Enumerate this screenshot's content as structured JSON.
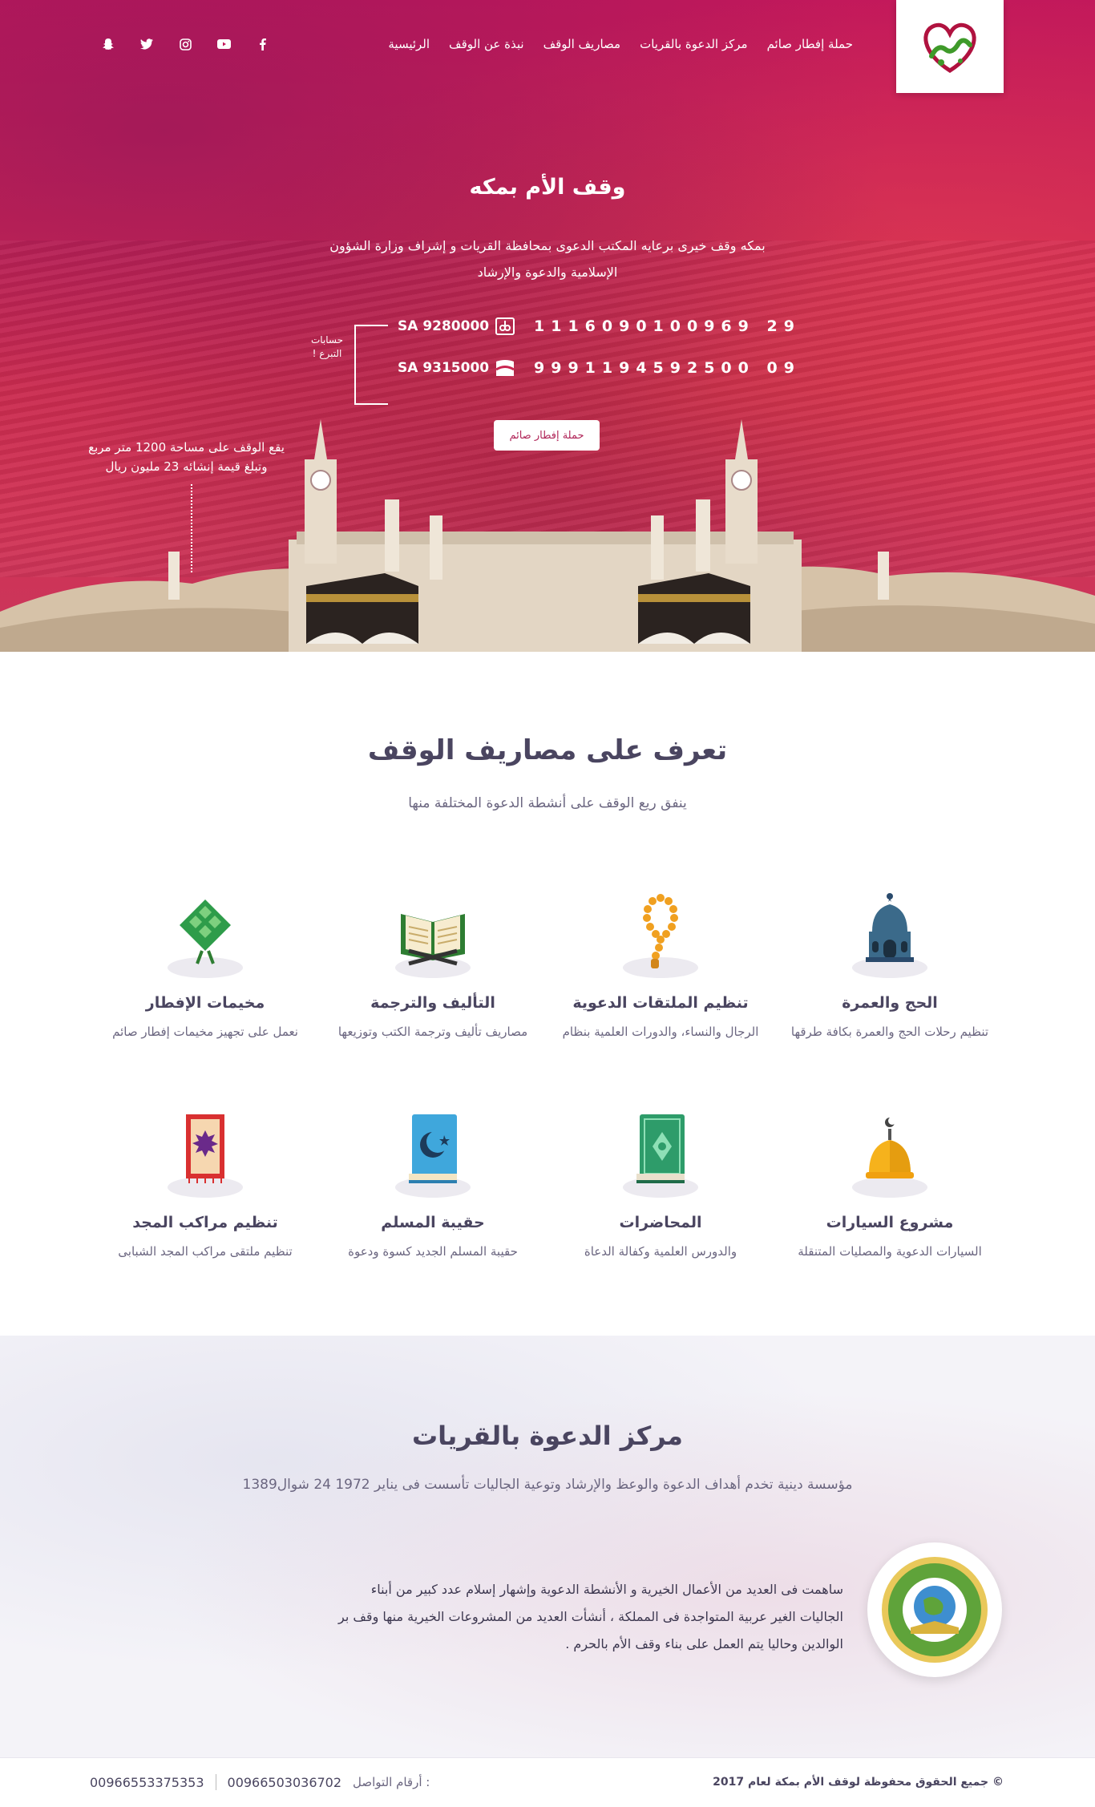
{
  "brand": {
    "logo_icon": "heart-waqf-logo"
  },
  "nav": {
    "items": [
      "الرئيسية",
      "نبذة عن الوقف",
      "مصاريف الوقف",
      "مركز الدعوة بالقريات",
      "حملة إفطار صائم"
    ]
  },
  "social": [
    "facebook-icon",
    "youtube-icon",
    "instagram-icon",
    "twitter-icon",
    "snapchat-icon"
  ],
  "hero": {
    "title": "وقف الأم بمكه",
    "description": "بمكه وقف خيرى برعايه المكتب الدعوى بمحافظة القريات و إشراف وزارة الشؤون الإسلامية والدعوة والإرشاد",
    "accounts_label": "حسابات التبرع !",
    "accounts": [
      {
        "code": "SA 9280000",
        "bank_icon": "alrajhi-bank-icon",
        "number": "1116090100969 29"
      },
      {
        "code": "SA 9315000",
        "bank_icon": "alinma-bank-icon",
        "number": "9991194592500 09"
      }
    ],
    "button": "حملة إفطار صائم",
    "side_note": "يقع الوقف على مساحة 1200 متر مربع وتبلغ قيمة إنشائه 23 مليون ريال"
  },
  "services": {
    "title": "تعرف على مصاريف الوقف",
    "subtitle": "ينفق ريع الوقف على أنشطة الدعوة المختلفة منها",
    "items": [
      {
        "icon": "mosque-dome-icon",
        "title": "الحج والعمرة",
        "desc": "تنظيم رحلات الحج والعمرة بكافة طرقها"
      },
      {
        "icon": "prayer-beads-icon",
        "title": "تنظيم الملتقات الدعوية",
        "desc": "الرجال والنساء، والدورات العلمية بنظام"
      },
      {
        "icon": "open-quran-icon",
        "title": "التأليف والترجمة",
        "desc": "مصاريف تأليف وترجمة الكتب وتوزيعها"
      },
      {
        "icon": "ketupat-icon",
        "title": "مخيمات الإفطار",
        "desc": "نعمل على تجهيز مخيمات إفطار صائم"
      },
      {
        "icon": "golden-dome-icon",
        "title": "مشروع السيارات",
        "desc": "السيارات الدعوية والمصليات المتنقلة"
      },
      {
        "icon": "green-book-icon",
        "title": "المحاضرات",
        "desc": "والدورس العلمية وكفالة الدعاة"
      },
      {
        "icon": "blue-book-crescent-icon",
        "title": "حقيبة المسلم",
        "desc": "حقيبة المسلم الجديد كسوة ودعوة"
      },
      {
        "icon": "prayer-rug-icon",
        "title": "تنظيم مراكب المجد",
        "desc": "تنظيم ملتقى مراكب المجد الشبابى"
      }
    ]
  },
  "center": {
    "title": "مركز الدعوة بالقريات",
    "subtitle": "مؤسسة دينية تخدم أهداف الدعوة والوعظ والإرشاد وتوعية الجاليات تأسست فى يناير 1972 24 شوال1389",
    "body": "ساهمت فى العديد من الأعمال الخيرية و الأنشطة الدعوية وإشهار إسلام عدد كبير من أبناء الجاليات الغير عربية المتواجدة فى المملكة ، أنشأت العديد من المشروعات الخيرية منها وقف بر الوالدين وحاليا يتم العمل على بناء وقف الأم بالحرم ."
  },
  "footer": {
    "copyright": "© جميع الحقوق محفوظة لوقف الأم بمكة لعام 2017",
    "phones_label": "أرقام التواصل :",
    "phone_1": "00966503036702",
    "phone_2": "00966553375353"
  },
  "colors": {
    "hero": "#cf2454",
    "text": "#4a4560",
    "accent": "#b02558"
  }
}
